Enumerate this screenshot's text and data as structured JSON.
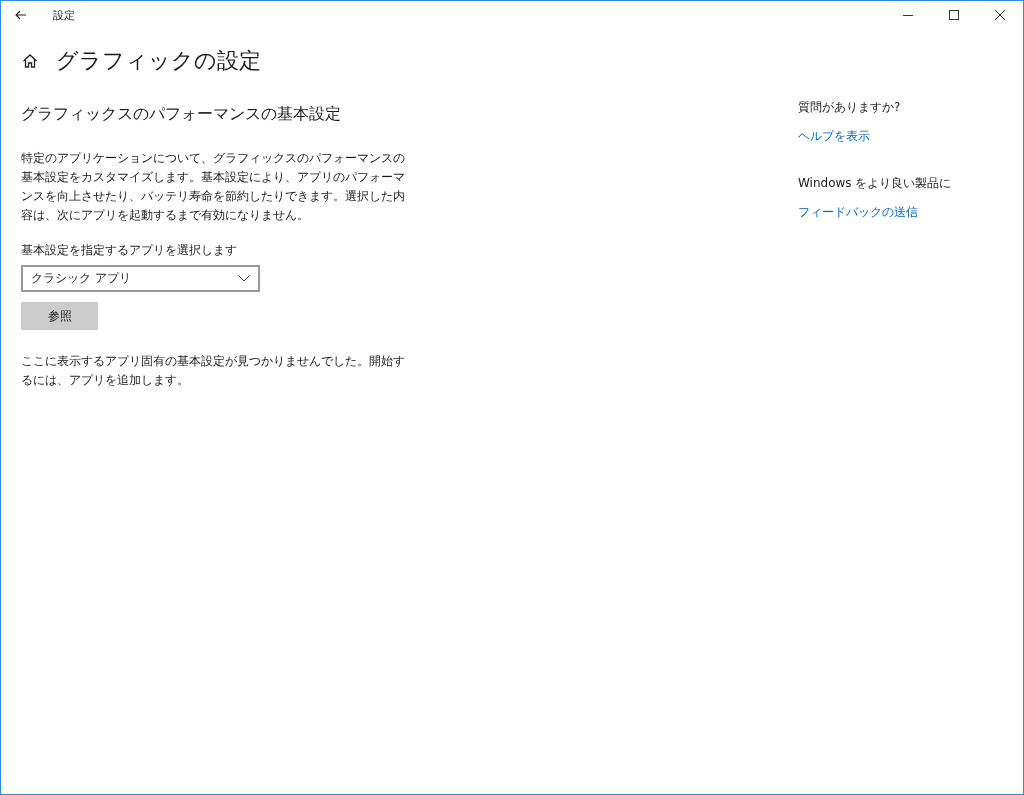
{
  "window": {
    "title": "設定"
  },
  "page": {
    "title": "グラフィックの設定"
  },
  "section": {
    "heading": "グラフィックスのパフォーマンスの基本設定",
    "description": "特定のアプリケーションについて、グラフィックスのパフォーマンスの基本設定をカスタマイズします。基本設定により、アプリのパフォーマンスを向上させたり、バッテリ寿命を節約したりできます。選択した内容は、次にアプリを起動するまで有効になりません。",
    "select_label": "基本設定を指定するアプリを選択します",
    "select_value": "クラシック アプリ",
    "browse_button": "参照",
    "empty_message": "ここに表示するアプリ固有の基本設定が見つかりませんでした。開始するには、アプリを追加します。"
  },
  "aside": [
    {
      "heading": "質問がありますか?",
      "link": "ヘルプを表示"
    },
    {
      "heading": "Windows をより良い製品に",
      "link": "フィードバックの送信"
    }
  ]
}
